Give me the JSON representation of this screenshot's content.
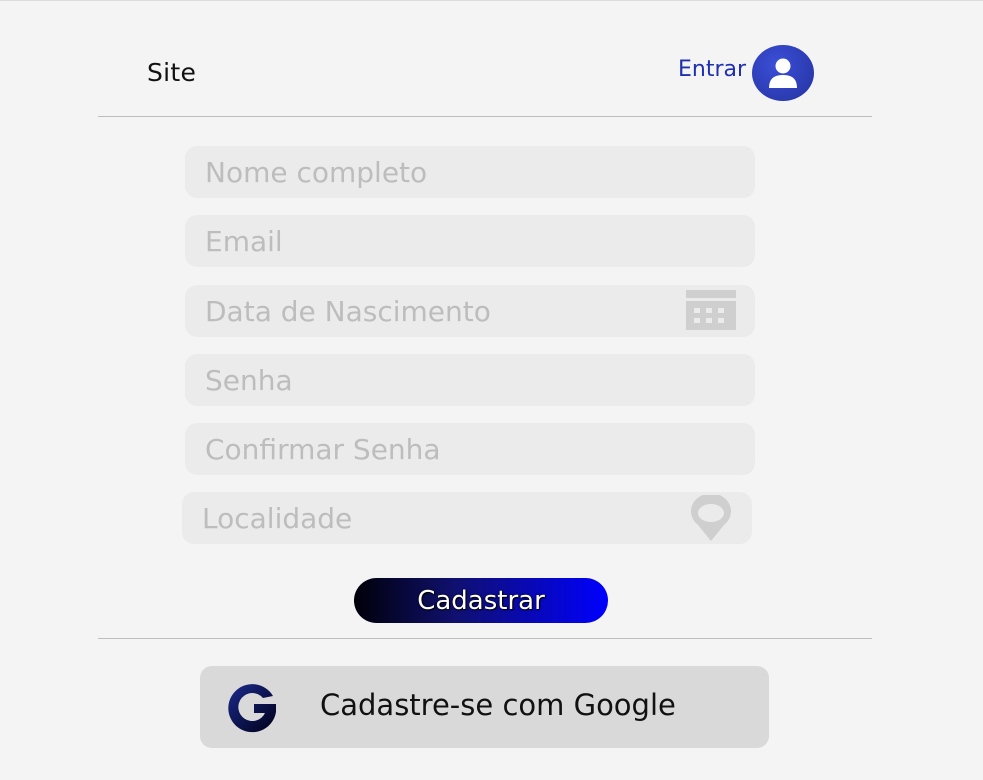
{
  "header": {
    "site_title": "Site",
    "login_label": "Entrar",
    "avatar_icon": "user-avatar-icon",
    "accent_color": "#24329e"
  },
  "form": {
    "full_name": {
      "placeholder": "Nome completo",
      "value": ""
    },
    "email": {
      "placeholder": "Email",
      "value": ""
    },
    "birth_date": {
      "placeholder": "Data de Nascimento",
      "value": "",
      "icon": "calendar-icon"
    },
    "password": {
      "placeholder": "Senha",
      "value": ""
    },
    "confirm_password": {
      "placeholder": "Confirmar Senha",
      "value": ""
    },
    "location": {
      "placeholder": "Localidade",
      "value": "",
      "icon": "location-pin-icon"
    },
    "submit_label": "Cadastrar",
    "submit_gradient": [
      "#000008",
      "#0000ff"
    ]
  },
  "social": {
    "google_label": "Cadastre-se com Google",
    "google_icon": "google-icon",
    "button_color": "#d9d9d9"
  }
}
